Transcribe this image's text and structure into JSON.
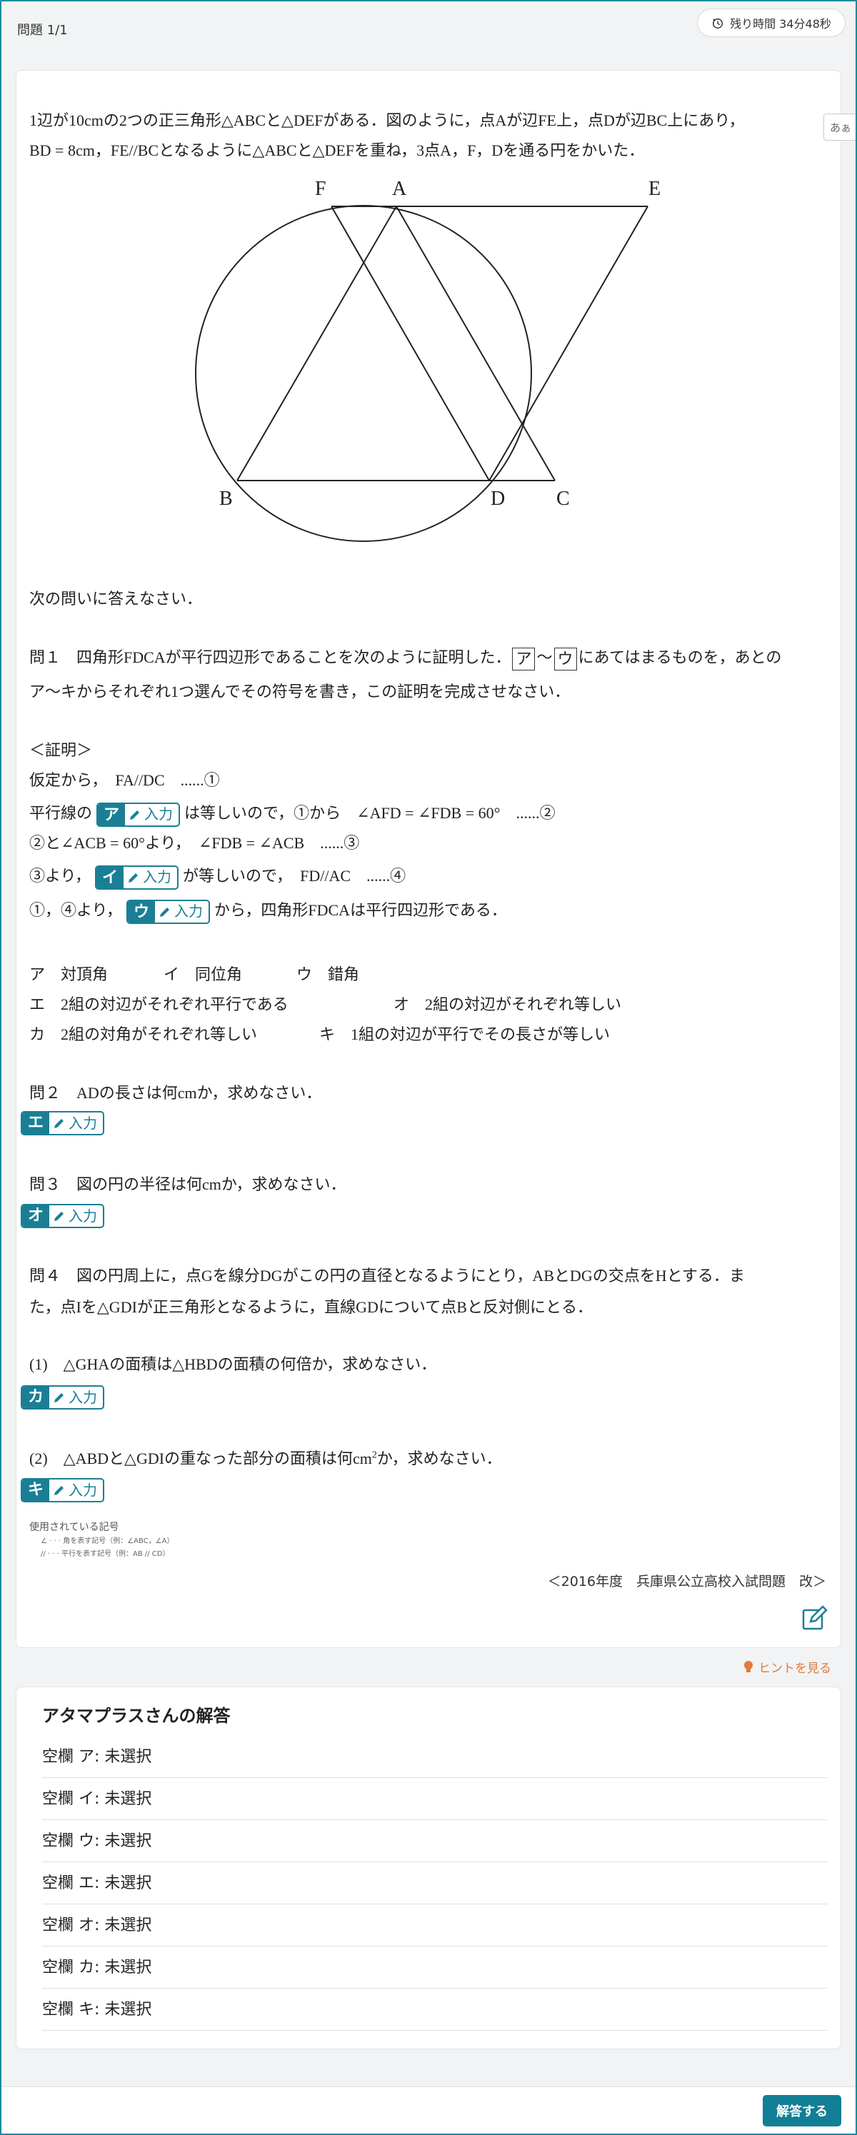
{
  "header": {
    "problem_label": "問題 1/1",
    "timer_label": "残り時間 34分48秒"
  },
  "font_toggle": "あぁ",
  "intro": [
    "1辺が10cmの2つの正三角形△ABCと△DEFがある．図のように，点Aが辺FE上，点Dが辺BC上にあり，",
    "BD = 8cm，FE//BCとなるように△ABCと△DEFを重ね，3点A，F，Dを通る円をかいた．"
  ],
  "figure_labels": {
    "F": "F",
    "A": "A",
    "E": "E",
    "B": "B",
    "D": "D",
    "C": "C"
  },
  "prompt": "次の問いに答えなさい．",
  "q1": {
    "pre": "問１　四角形FDCAが平行四辺形であることを次のように証明した．",
    "box_a": "ア",
    "tilde": "〜",
    "box_c": "ウ",
    "post": "にあてはまるものを，あとの",
    "line2": "ア〜キからそれぞれ1つ選んでその符号を書き，この証明を完成させなさい．"
  },
  "proof": {
    "head": "＜証明＞",
    "l1": "仮定から，　FA//DC　......①",
    "l2_pre": "平行線の",
    "l2_post": "は等しいので，①から　∠AFD = ∠FDB = 60°　......②",
    "l3": "②と∠ACB = 60°より，　∠FDB = ∠ACB　......③",
    "l4_pre": "③より，",
    "l4_post": "が等しいので，　FD//AC　......④",
    "l5_pre": "①，④より，",
    "l5_post": "から，四角形FDCAは平行四辺形である．"
  },
  "blank_input_label": "入力",
  "blanks": {
    "a": "ア",
    "i": "イ",
    "u": "ウ",
    "e": "エ",
    "o": "オ",
    "ka": "カ",
    "ki": "キ"
  },
  "choices": {
    "a": "ア　対頂角",
    "i": "イ　同位角",
    "u": "ウ　錯角",
    "e": "エ　2組の対辺がそれぞれ平行である",
    "o": "オ　2組の対辺がそれぞれ等しい",
    "ka": "カ　2組の対角がそれぞれ等しい",
    "ki": "キ　1組の対辺が平行でその長さが等しい"
  },
  "q2": "問２　ADの長さは何cmか，求めなさい．",
  "q3": "問３　図の円の半径は何cmか，求めなさい．",
  "q4": {
    "l1": "問４　図の円周上に，点Gを線分DGがこの円の直径となるようにとり，ABとDGの交点をHとする．ま",
    "l2": "た，点Iを△GDIが正三角形となるように，直線GDについて点Bと反対側にとる．"
  },
  "q4_1": "(1)　△GHAの面積は△HBDの面積の何倍か，求めなさい．",
  "q4_2_pre": "(2)　△ABDと△GDIの重なった部分の面積は何cm",
  "q4_2_sup": "2",
  "q4_2_post": "か，求めなさい．",
  "symbols": {
    "title": "使用されている記号",
    "l1": "∠ · · · 角を表す記号（例：∠ABC，∠A）",
    "l2": "// · · · 平行を表す記号（例：AB // CD）"
  },
  "source": "＜2016年度　兵庫県公立高校入試問題　改＞",
  "hint": "ヒントを見る",
  "answers": {
    "title": "アタマプラスさんの解答",
    "rows": [
      "空欄 ア: 未選択",
      "空欄 イ: 未選択",
      "空欄 ウ: 未選択",
      "空欄 エ: 未選択",
      "空欄 オ: 未選択",
      "空欄 カ: 未選択",
      "空欄 キ: 未選択"
    ]
  },
  "submit_label": "解答する"
}
